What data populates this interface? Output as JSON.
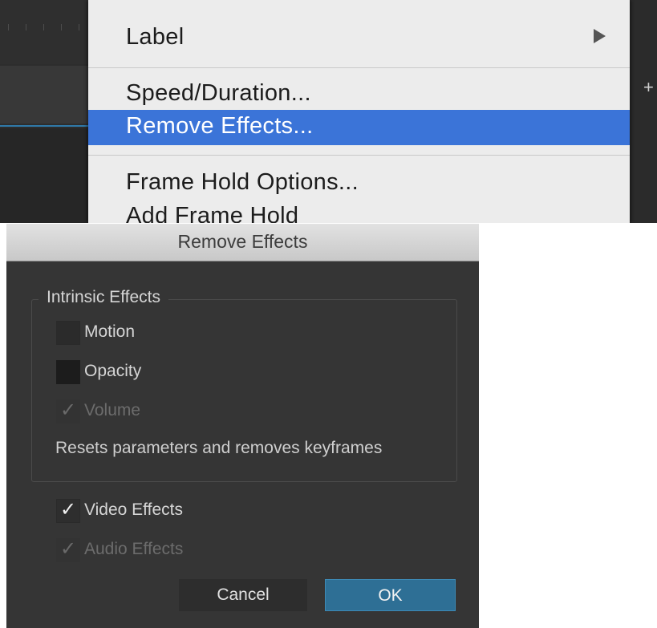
{
  "context_menu": {
    "items": [
      {
        "label": "Label",
        "has_submenu": true
      },
      {
        "label": "Speed/Duration..."
      },
      {
        "label": "Remove Effects...",
        "highlighted": true
      },
      {
        "label": "Frame Hold Options..."
      },
      {
        "label": "Add Frame Hold"
      }
    ],
    "highlight_color": "#3b74d8"
  },
  "timeline": {
    "plus_icon": "+"
  },
  "dialog": {
    "title": "Remove Effects",
    "group_label": "Intrinsic Effects",
    "intrinsic": [
      {
        "label": "Motion",
        "checked": false,
        "enabled": true
      },
      {
        "label": "Opacity",
        "checked": false,
        "enabled": true
      },
      {
        "label": "Volume",
        "checked": true,
        "enabled": false
      }
    ],
    "description": "Resets parameters and removes keyframes",
    "video_effects": {
      "label": "Video Effects",
      "checked": true,
      "enabled": true
    },
    "audio_effects": {
      "label": "Audio Effects",
      "checked": true,
      "enabled": false
    },
    "check_glyph": "✓",
    "cancel_label": "Cancel",
    "ok_label": "OK",
    "ok_color": "#2e6f95"
  }
}
